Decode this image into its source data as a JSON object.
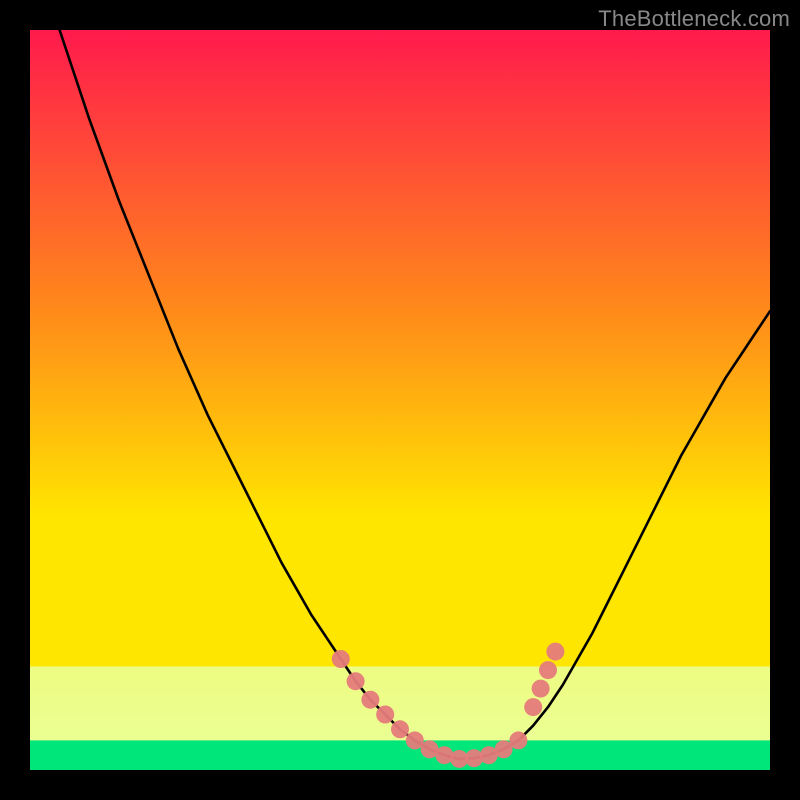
{
  "watermark": "TheBottleneck.com",
  "gradient": {
    "top": "#ff1a4d",
    "mid1": "#ff8a1a",
    "mid2": "#ffe600",
    "bottom_band": "#eaff99",
    "green": "#00e67a"
  },
  "curve_color": "#000000",
  "marker_color": "#e57b7b",
  "chart_data": {
    "type": "line",
    "title": "",
    "xlabel": "",
    "ylabel": "",
    "xlim": [
      0,
      100
    ],
    "ylim": [
      0,
      100
    ],
    "series": [
      {
        "name": "bottleneck-curve",
        "x": [
          4,
          6,
          8,
          10,
          12,
          14,
          16,
          18,
          20,
          22,
          24,
          26,
          28,
          30,
          32,
          34,
          36,
          38,
          40,
          42,
          44,
          46,
          48,
          50,
          52,
          54,
          56,
          58,
          60,
          62,
          64,
          66,
          68,
          70,
          72,
          74,
          76,
          78,
          80,
          82,
          84,
          86,
          88,
          90,
          92,
          94,
          96,
          98,
          100
        ],
        "y": [
          100,
          94,
          88,
          82.5,
          77,
          72,
          67,
          62,
          57,
          52.5,
          48,
          44,
          40,
          36,
          32,
          28,
          24.5,
          21,
          18,
          15,
          12,
          9.5,
          7.5,
          5.5,
          4,
          2.8,
          2,
          1.5,
          1.6,
          2,
          2.8,
          4,
          6,
          8.5,
          11.5,
          15,
          18.5,
          22.5,
          26.5,
          30.5,
          34.5,
          38.5,
          42.5,
          46,
          49.5,
          53,
          56,
          59,
          62
        ]
      }
    ],
    "markers": {
      "name": "highlighted-band",
      "x": [
        42,
        44,
        46,
        48,
        50,
        52,
        54,
        56,
        58,
        60,
        62,
        64,
        66,
        68,
        69,
        70,
        71
      ],
      "y": [
        15,
        12,
        9.5,
        7.5,
        5.5,
        4,
        2.8,
        2,
        1.5,
        1.6,
        2,
        2.8,
        4,
        8.5,
        11,
        13.5,
        16
      ]
    },
    "green_band_y_range": [
      0,
      4
    ],
    "pale_band_y_range": [
      4,
      14
    ]
  }
}
